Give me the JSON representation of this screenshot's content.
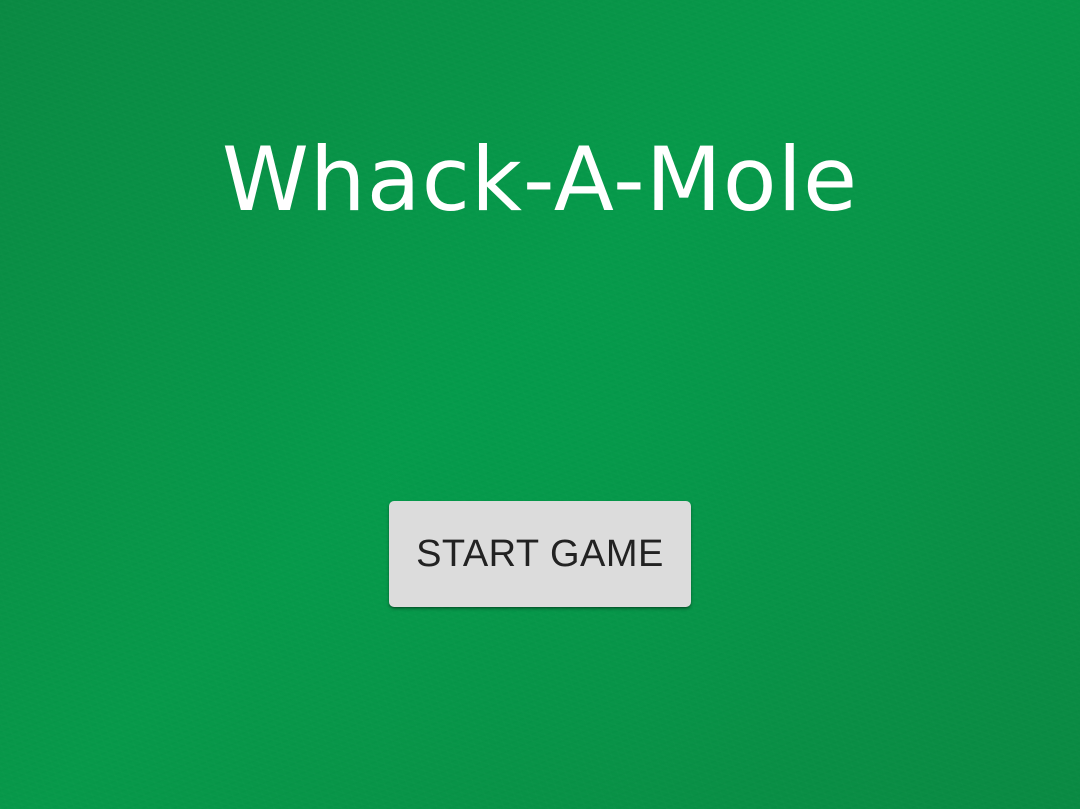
{
  "game": {
    "title": "Whack-A-Mole",
    "start_button_label": "START GAME"
  },
  "colors": {
    "background": "#07994a",
    "title_text": "#ffffff",
    "button_bg": "#dcdcdc",
    "button_text": "#222222"
  }
}
